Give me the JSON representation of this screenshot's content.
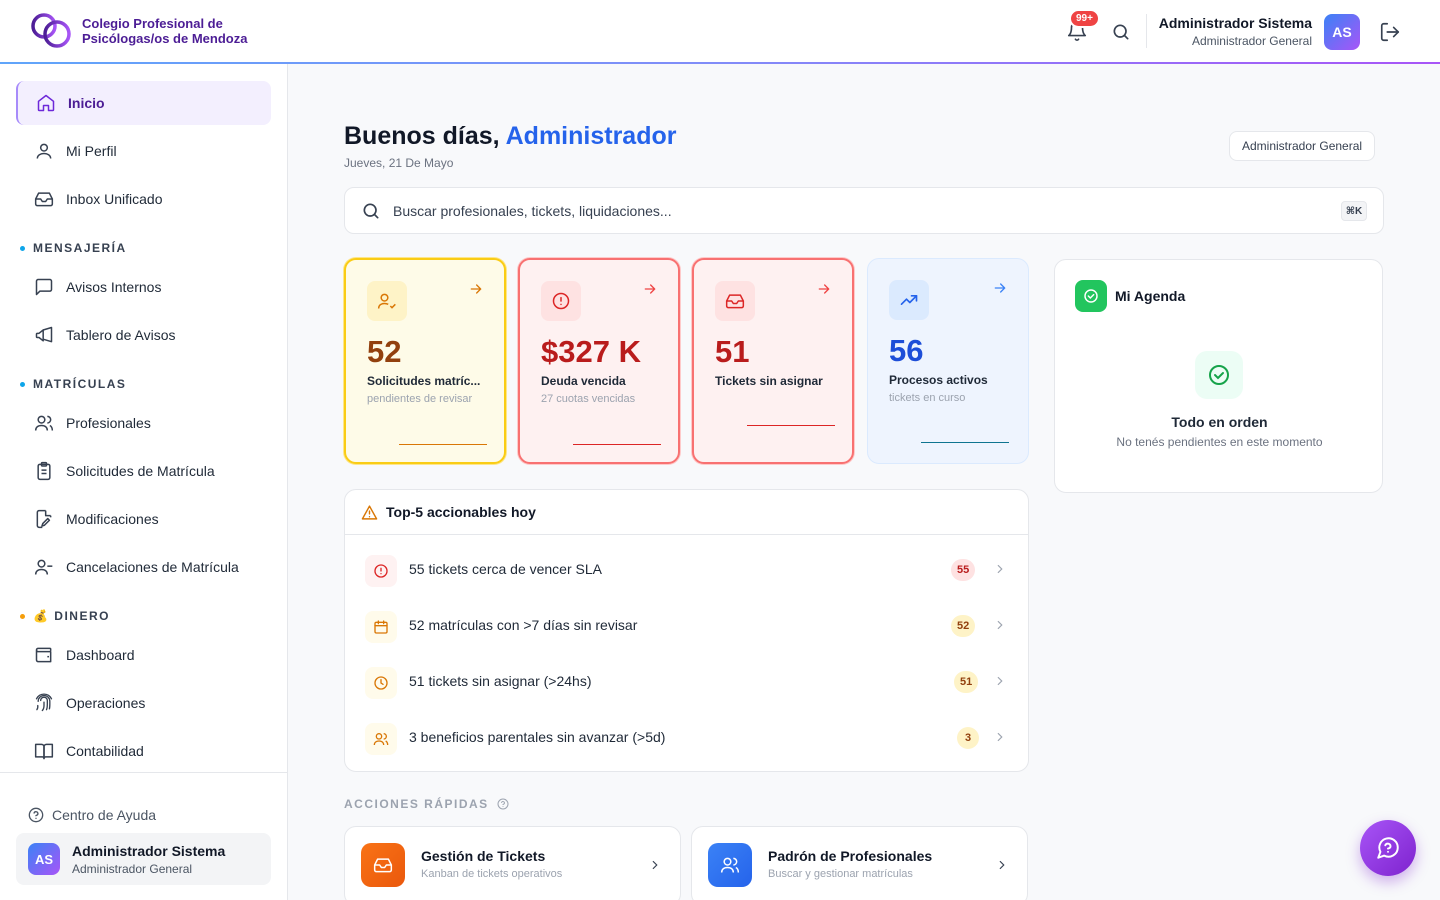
{
  "header": {
    "brand_line1": "Colegio Profesional de",
    "brand_line2": "Psicólogas/os de Mendoza",
    "notif_badge": "99+",
    "user_name": "Administrador Sistema",
    "user_role": "Administrador General",
    "avatar_initials": "AS"
  },
  "sidebar": {
    "items": [
      {
        "label": "Inicio",
        "icon": "home-icon",
        "active": true
      },
      {
        "label": "Mi Perfil",
        "icon": "user-icon"
      },
      {
        "label": "Inbox Unificado",
        "icon": "inbox-icon"
      }
    ],
    "section_mensajeria": "MENSAJERÍA",
    "mensajeria": [
      {
        "label": "Avisos Internos",
        "icon": "message-icon"
      },
      {
        "label": "Tablero de Avisos",
        "icon": "megaphone-icon"
      }
    ],
    "section_matriculas": "MATRÍCULAS",
    "matriculas": [
      {
        "label": "Profesionales",
        "icon": "users-icon"
      },
      {
        "label": "Solicitudes de Matrícula",
        "icon": "clipboard-icon"
      },
      {
        "label": "Modificaciones",
        "icon": "file-edit-icon"
      },
      {
        "label": "Cancelaciones de Matrícula",
        "icon": "user-minus-icon"
      }
    ],
    "section_dinero": "💰 DINERO",
    "dinero": [
      {
        "label": "Dashboard",
        "icon": "wallet-icon"
      },
      {
        "label": "Operaciones",
        "icon": "fingerprint-icon"
      },
      {
        "label": "Contabilidad",
        "icon": "book-icon"
      }
    ],
    "help_label": "Centro de Ayuda",
    "user_name": "Administrador Sistema",
    "user_role": "Administrador General",
    "avatar_initials": "AS"
  },
  "main": {
    "greeting_prefix": "Buenos días,",
    "greeting_name": "Administrador",
    "date": "Jueves, 21 De Mayo",
    "role_pill": "Administrador General",
    "search_placeholder": "Buscar profesionales, tickets, liquidaciones...",
    "search_shortcut": "⌘K"
  },
  "kpis": [
    {
      "value": "52",
      "label": "Solicitudes matríc...",
      "sub": "pendientes de revisar",
      "color": "#92400e",
      "theme": "yellow"
    },
    {
      "value": "$327 K",
      "label": "Deuda vencida",
      "sub": "27 cuotas vencidas",
      "color": "#b91c1c",
      "theme": "red"
    },
    {
      "value": "51",
      "label": "Tickets sin asignar",
      "sub": "",
      "color": "#b91c1c",
      "theme": "red"
    },
    {
      "value": "56",
      "label": "Procesos activos",
      "sub": "tickets en curso",
      "color": "#1d4ed8",
      "theme": "blue"
    }
  ],
  "agenda": {
    "title": "Mi Agenda",
    "status_title": "Todo en orden",
    "status_sub": "No tenés pendientes en este momento"
  },
  "top5": {
    "title": "Top-5 accionables hoy",
    "rows": [
      {
        "text": "55 tickets cerca de vencer SLA",
        "count": "55",
        "icon": "alert-circle-icon"
      },
      {
        "text": "52 matrículas con >7 días sin revisar",
        "count": "52",
        "icon": "calendar-icon"
      },
      {
        "text": "51 tickets sin asignar (>24hs)",
        "count": "51",
        "icon": "clock-icon"
      },
      {
        "text": "3 beneficios parentales sin avanzar (>5d)",
        "count": "3",
        "icon": "users-icon"
      }
    ]
  },
  "quick_actions": {
    "title": "ACCIONES RÁPIDAS",
    "cards": [
      {
        "title": "Gestión de Tickets",
        "sub": "Kanban de tickets operativos",
        "icon": "inbox-icon"
      },
      {
        "title": "Padrón de Profesionales",
        "sub": "Buscar y gestionar matrículas",
        "icon": "users-icon"
      }
    ]
  }
}
